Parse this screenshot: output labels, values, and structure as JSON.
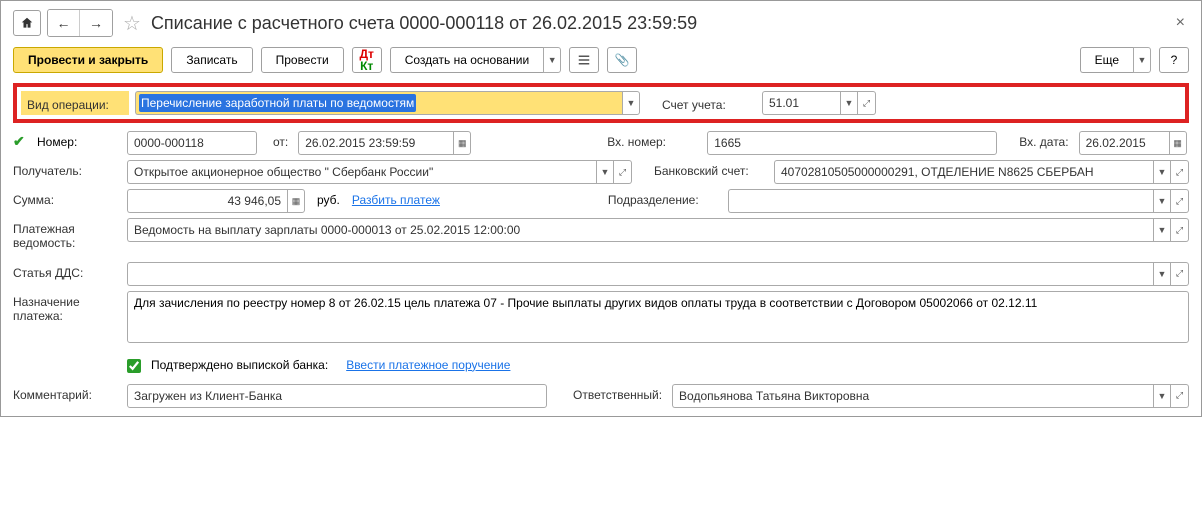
{
  "header": {
    "title": "Списание с расчетного счета 0000-000118 от 26.02.2015 23:59:59"
  },
  "toolbar": {
    "post_close": "Провести и закрыть",
    "save": "Записать",
    "post": "Провести",
    "create_based": "Создать на основании",
    "more": "Еще"
  },
  "fields": {
    "operation_type_label": "Вид операции:",
    "operation_type_value": "Перечисление заработной платы по ведомостям",
    "account_label": "Счет учета:",
    "account_value": "51.01",
    "number_label": "Номер:",
    "number_value": "0000-000118",
    "from_label": "от:",
    "from_value": "26.02.2015 23:59:59",
    "ext_number_label": "Вх. номер:",
    "ext_number_value": "1665",
    "ext_date_label": "Вх. дата:",
    "ext_date_value": "26.02.2015",
    "recipient_label": "Получатель:",
    "recipient_value": "Открытое акционерное общество \" Сбербанк России\"",
    "bank_account_label": "Банковский счет:",
    "bank_account_value": "40702810505000000291, ОТДЕЛЕНИЕ N8625 СБЕРБАН",
    "amount_label": "Сумма:",
    "amount_value": "43 946,05",
    "currency": "руб.",
    "split_payment": "Разбить платеж",
    "division_label": "Подразделение:",
    "division_value": "",
    "payroll_label": "Платежная ведомость:",
    "payroll_value": "Ведомость на выплату зарплаты 0000-000013 от 25.02.2015 12:00:00",
    "dds_label": "Статья ДДС:",
    "dds_value": "",
    "purpose_label": "Назначение платежа:",
    "purpose_value": "Для зачисления по реестру номер 8 от 26.02.15 цель платежа 07 - Прочие выплаты других видов оплаты труда в соответствии с Договором 05002066 от 02.12.11",
    "confirmed_label": "Подтверждено выпиской банка:",
    "enter_payment": "Ввести платежное поручение",
    "comment_label": "Комментарий:",
    "comment_value": "Загружен из Клиент-Банка",
    "responsible_label": "Ответственный:",
    "responsible_value": "Водопьянова Татьяна Викторовна"
  }
}
